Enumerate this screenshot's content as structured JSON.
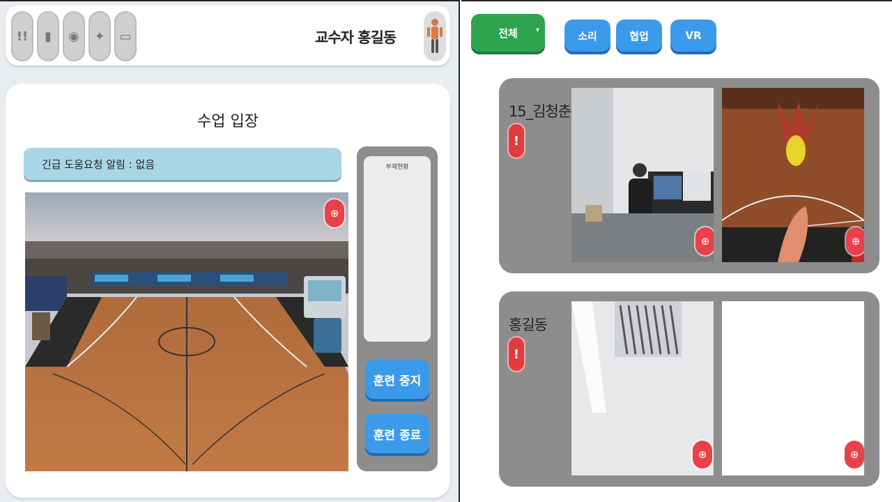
{
  "toolbar": {
    "tools": [
      {
        "name": "alert-tool",
        "glyph": "!!"
      },
      {
        "name": "phone-tool",
        "glyph": "▮"
      },
      {
        "name": "camera-tool",
        "glyph": "◉"
      },
      {
        "name": "idea-tool",
        "glyph": "✦"
      },
      {
        "name": "screen-tool",
        "glyph": "▭"
      }
    ],
    "professor_name": "교수자 홍길동"
  },
  "class": {
    "title": "수업 입장",
    "emergency_status": "긴급 도움요청 알림 : 없음",
    "info_label": "부재현황",
    "buttons": {
      "pause": "훈련 중지",
      "end": "훈련 종료"
    }
  },
  "filters": {
    "all": "전체",
    "chevron": "▾",
    "options": [
      "소리",
      "협업",
      "VR"
    ]
  },
  "students": [
    {
      "name": "15_김청춘",
      "alarm": "!"
    },
    {
      "name": "홍길동",
      "alarm": "!"
    }
  ],
  "icons": {
    "zoom": "⊕"
  },
  "colors": {
    "accent_blue": "#3b9ae9",
    "accent_green": "#2ea44f",
    "alert_red": "#e23b3b",
    "info_bar": "#a9d6e6",
    "panel_gray": "#8d8d8d"
  }
}
